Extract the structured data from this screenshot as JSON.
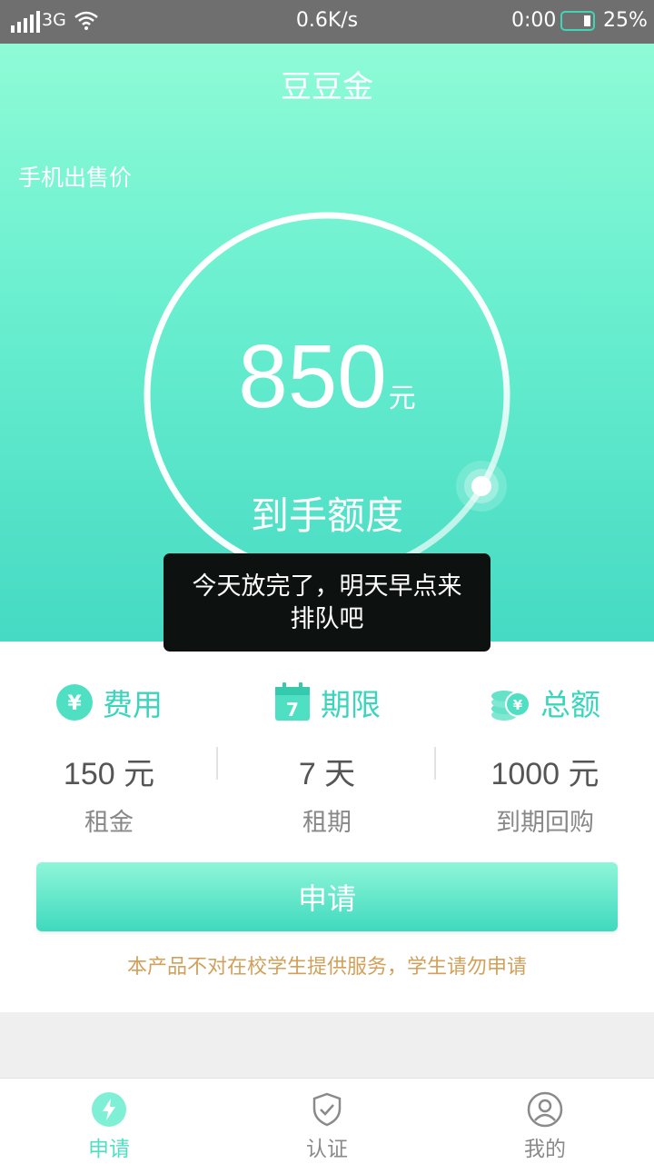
{
  "status_bar": {
    "network": "3G",
    "speed": "0.6K/s",
    "time": "0:00",
    "battery": "25%"
  },
  "header": {
    "title": "豆豆金"
  },
  "hero": {
    "phone_price_label": "手机出售价",
    "amount": "850",
    "amount_unit": "元",
    "amount_label": "到手额度"
  },
  "toast": {
    "line1": "今天放完了，明天早点来",
    "line2": "排队吧"
  },
  "metrics": [
    {
      "icon": "yen-icon",
      "title": "费用",
      "value": "150 元",
      "sub": "租金"
    },
    {
      "icon": "calendar-icon",
      "title": "期限",
      "value": "7 天",
      "sub": "租期",
      "icon_text": "7"
    },
    {
      "icon": "coins-icon",
      "title": "总额",
      "value": "1000 元",
      "sub": "到期回购"
    }
  ],
  "apply_button": "申请",
  "notice": "本产品不对在校学生提供服务，学生请勿申请",
  "tabs": [
    {
      "label": "申请",
      "icon": "lightning-icon",
      "active": true
    },
    {
      "label": "认证",
      "icon": "shield-check-icon",
      "active": false
    },
    {
      "label": "我的",
      "icon": "user-icon",
      "active": false
    }
  ],
  "colors": {
    "accent": "#3ad6bb",
    "notice": "#d1a05b",
    "inactive": "#8a8a8a"
  }
}
